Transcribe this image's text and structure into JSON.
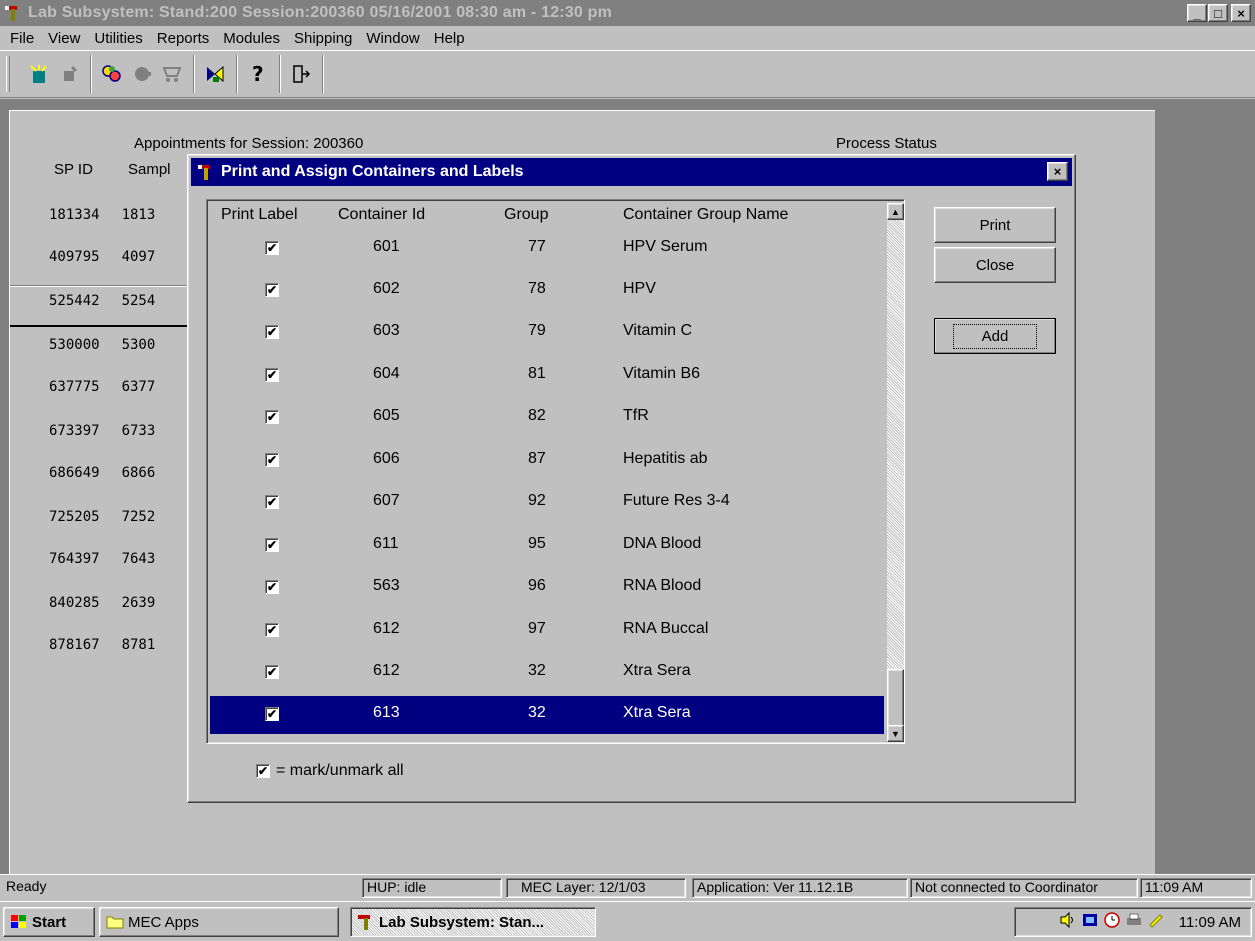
{
  "window": {
    "title": "Lab Subsystem: Stand:200 Session:200360 05/16/2001 08:30 am - 12:30 pm",
    "buttons": [
      "_",
      "□",
      "×"
    ]
  },
  "menubar": [
    "File",
    "View",
    "Utilities",
    "Reports",
    "Modules",
    "Shipping",
    "Window",
    "Help"
  ],
  "toolbar_icons": [
    "new-icon",
    "pen-icon",
    "people-icon",
    "record-icon",
    "cart-icon",
    "container-icon",
    "help-icon",
    "exit-icon"
  ],
  "background": {
    "appointments_label": "Appointments for Session: 200360",
    "process_status_label": "Process Status",
    "col_spid": "SP ID",
    "col_sample": "Sampl",
    "rows": [
      {
        "spid": "181334",
        "sample": "1813"
      },
      {
        "spid": "409795",
        "sample": "4097"
      },
      {
        "spid": "525442",
        "sample": "5254"
      },
      {
        "spid": "530000",
        "sample": "5300"
      },
      {
        "spid": "637775",
        "sample": "6377"
      },
      {
        "spid": "673397",
        "sample": "6733"
      },
      {
        "spid": "686649",
        "sample": "6866"
      },
      {
        "spid": "725205",
        "sample": "7252"
      },
      {
        "spid": "764397",
        "sample": "7643"
      },
      {
        "spid": "840285",
        "sample": "2639"
      },
      {
        "spid": "878167",
        "sample": "8781"
      }
    ]
  },
  "dialog": {
    "title": "Print and Assign Containers and Labels",
    "close": "×",
    "headers": {
      "print_label": "Print Label",
      "container_id": "Container Id",
      "group": "Group",
      "group_name": "Container Group Name"
    },
    "rows": [
      {
        "checked": "✔",
        "container_id": "601",
        "group": "77",
        "name": "HPV Serum"
      },
      {
        "checked": "✔",
        "container_id": "602",
        "group": "78",
        "name": "HPV"
      },
      {
        "checked": "✔",
        "container_id": "603",
        "group": "79",
        "name": "Vitamin C"
      },
      {
        "checked": "✔",
        "container_id": "604",
        "group": "81",
        "name": "Vitamin B6"
      },
      {
        "checked": "✔",
        "container_id": "605",
        "group": "82",
        "name": "TfR"
      },
      {
        "checked": "✔",
        "container_id": "606",
        "group": "87",
        "name": "Hepatitis ab"
      },
      {
        "checked": "✔",
        "container_id": "607",
        "group": "92",
        "name": "Future Res 3-4"
      },
      {
        "checked": "✔",
        "container_id": "611",
        "group": "95",
        "name": "DNA Blood"
      },
      {
        "checked": "✔",
        "container_id": "563",
        "group": "96",
        "name": "RNA Blood"
      },
      {
        "checked": "✔",
        "container_id": "612",
        "group": "97",
        "name": "RNA Buccal"
      },
      {
        "checked": "✔",
        "container_id": "612",
        "group": "32",
        "name": "Xtra Sera"
      },
      {
        "checked": "✔",
        "container_id": "613",
        "group": "32",
        "name": "Xtra Sera"
      }
    ],
    "print_button": "Print",
    "close_button": "Close",
    "add_button": "Add",
    "mark_all_check": "✔",
    "mark_all_label": "= mark/unmark all"
  },
  "statusbar": {
    "ready": "Ready",
    "hup": "HUP: idle",
    "mec_layer": "MEC Layer: 12/1/03",
    "application": "Application: Ver 11.12.1B",
    "coordinator": "Not connected to Coordinator",
    "time": "11:09 AM"
  },
  "taskbar": {
    "start": "Start",
    "task1": "MEC Apps",
    "task2": "Lab Subsystem: Stan...",
    "clock": "11:09 AM"
  },
  "colors": {
    "selection": "#000080",
    "dialog_title": "#000080",
    "face": "#c0c0c0",
    "desktop": "#808080"
  }
}
